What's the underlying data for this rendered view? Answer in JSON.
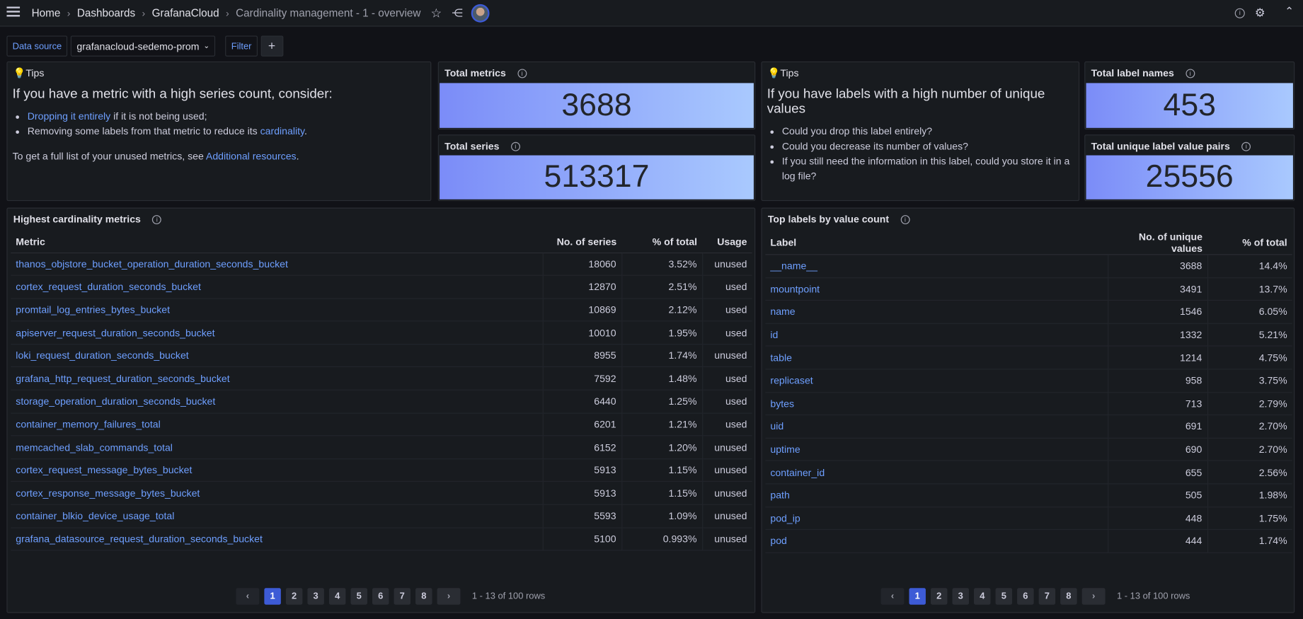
{
  "breadcrumb": [
    "Home",
    "Dashboards",
    "GrafanaCloud",
    "Cardinality management - 1 - overview"
  ],
  "controls": {
    "datasource_label": "Data source",
    "datasource_value": "grafanacloud-sedemo-prom",
    "filter_label": "Filter",
    "add_label": "+"
  },
  "tips1": {
    "title": "Tips",
    "heading": "If you have a metric with a high series count, consider:",
    "item1_link": "Dropping it entirely",
    "item1_rest": " if it is not being used;",
    "item2_text": "Removing some labels from that metric to reduce its ",
    "item2_link": "cardinality",
    "item2_end": ".",
    "footer_text": "To get a full list of your unused metrics, see ",
    "footer_link": "Additional resources",
    "footer_end": "."
  },
  "stats": {
    "total_metrics": {
      "title": "Total metrics",
      "value": "3688"
    },
    "total_series": {
      "title": "Total series",
      "value": "513317"
    },
    "total_label_names": {
      "title": "Total label names",
      "value": "453"
    },
    "total_pairs": {
      "title": "Total unique label value pairs",
      "value": "25556"
    }
  },
  "tips2": {
    "title": "Tips",
    "heading": "If you have labels with a high number of unique values",
    "items": [
      "Could you drop this label entirely?",
      "Could you decrease its number of values?",
      "If you still need the information in this label, could you store it in a log file?"
    ]
  },
  "metrics_table": {
    "title": "Highest cardinality metrics",
    "columns": [
      "Metric",
      "No. of series",
      "% of total",
      "Usage"
    ],
    "rows": [
      [
        "thanos_objstore_bucket_operation_duration_seconds_bucket",
        "18060",
        "3.52%",
        "unused"
      ],
      [
        "cortex_request_duration_seconds_bucket",
        "12870",
        "2.51%",
        "used"
      ],
      [
        "promtail_log_entries_bytes_bucket",
        "10869",
        "2.12%",
        "used"
      ],
      [
        "apiserver_request_duration_seconds_bucket",
        "10010",
        "1.95%",
        "used"
      ],
      [
        "loki_request_duration_seconds_bucket",
        "8955",
        "1.74%",
        "unused"
      ],
      [
        "grafana_http_request_duration_seconds_bucket",
        "7592",
        "1.48%",
        "used"
      ],
      [
        "storage_operation_duration_seconds_bucket",
        "6440",
        "1.25%",
        "used"
      ],
      [
        "container_memory_failures_total",
        "6201",
        "1.21%",
        "used"
      ],
      [
        "memcached_slab_commands_total",
        "6152",
        "1.20%",
        "unused"
      ],
      [
        "cortex_request_message_bytes_bucket",
        "5913",
        "1.15%",
        "unused"
      ],
      [
        "cortex_response_message_bytes_bucket",
        "5913",
        "1.15%",
        "unused"
      ],
      [
        "container_blkio_device_usage_total",
        "5593",
        "1.09%",
        "unused"
      ],
      [
        "grafana_datasource_request_duration_seconds_bucket",
        "5100",
        "0.993%",
        "unused"
      ]
    ],
    "pages": [
      "1",
      "2",
      "3",
      "4",
      "5",
      "6",
      "7",
      "8"
    ],
    "current_page": 1,
    "rows_info": "1 - 13 of 100 rows"
  },
  "labels_table": {
    "title": "Top labels by value count",
    "columns": [
      "Label",
      "No. of unique values",
      "% of total"
    ],
    "rows": [
      [
        "__name__",
        "3688",
        "14.4%"
      ],
      [
        "mountpoint",
        "3491",
        "13.7%"
      ],
      [
        "name",
        "1546",
        "6.05%"
      ],
      [
        "id",
        "1332",
        "5.21%"
      ],
      [
        "table",
        "1214",
        "4.75%"
      ],
      [
        "replicaset",
        "958",
        "3.75%"
      ],
      [
        "bytes",
        "713",
        "2.79%"
      ],
      [
        "uid",
        "691",
        "2.70%"
      ],
      [
        "uptime",
        "690",
        "2.70%"
      ],
      [
        "container_id",
        "655",
        "2.56%"
      ],
      [
        "path",
        "505",
        "1.98%"
      ],
      [
        "pod_ip",
        "448",
        "1.75%"
      ],
      [
        "pod",
        "444",
        "1.74%"
      ]
    ],
    "pages": [
      "1",
      "2",
      "3",
      "4",
      "5",
      "6",
      "7",
      "8"
    ],
    "current_page": 1,
    "rows_info": "1 - 13 of 100 rows"
  }
}
